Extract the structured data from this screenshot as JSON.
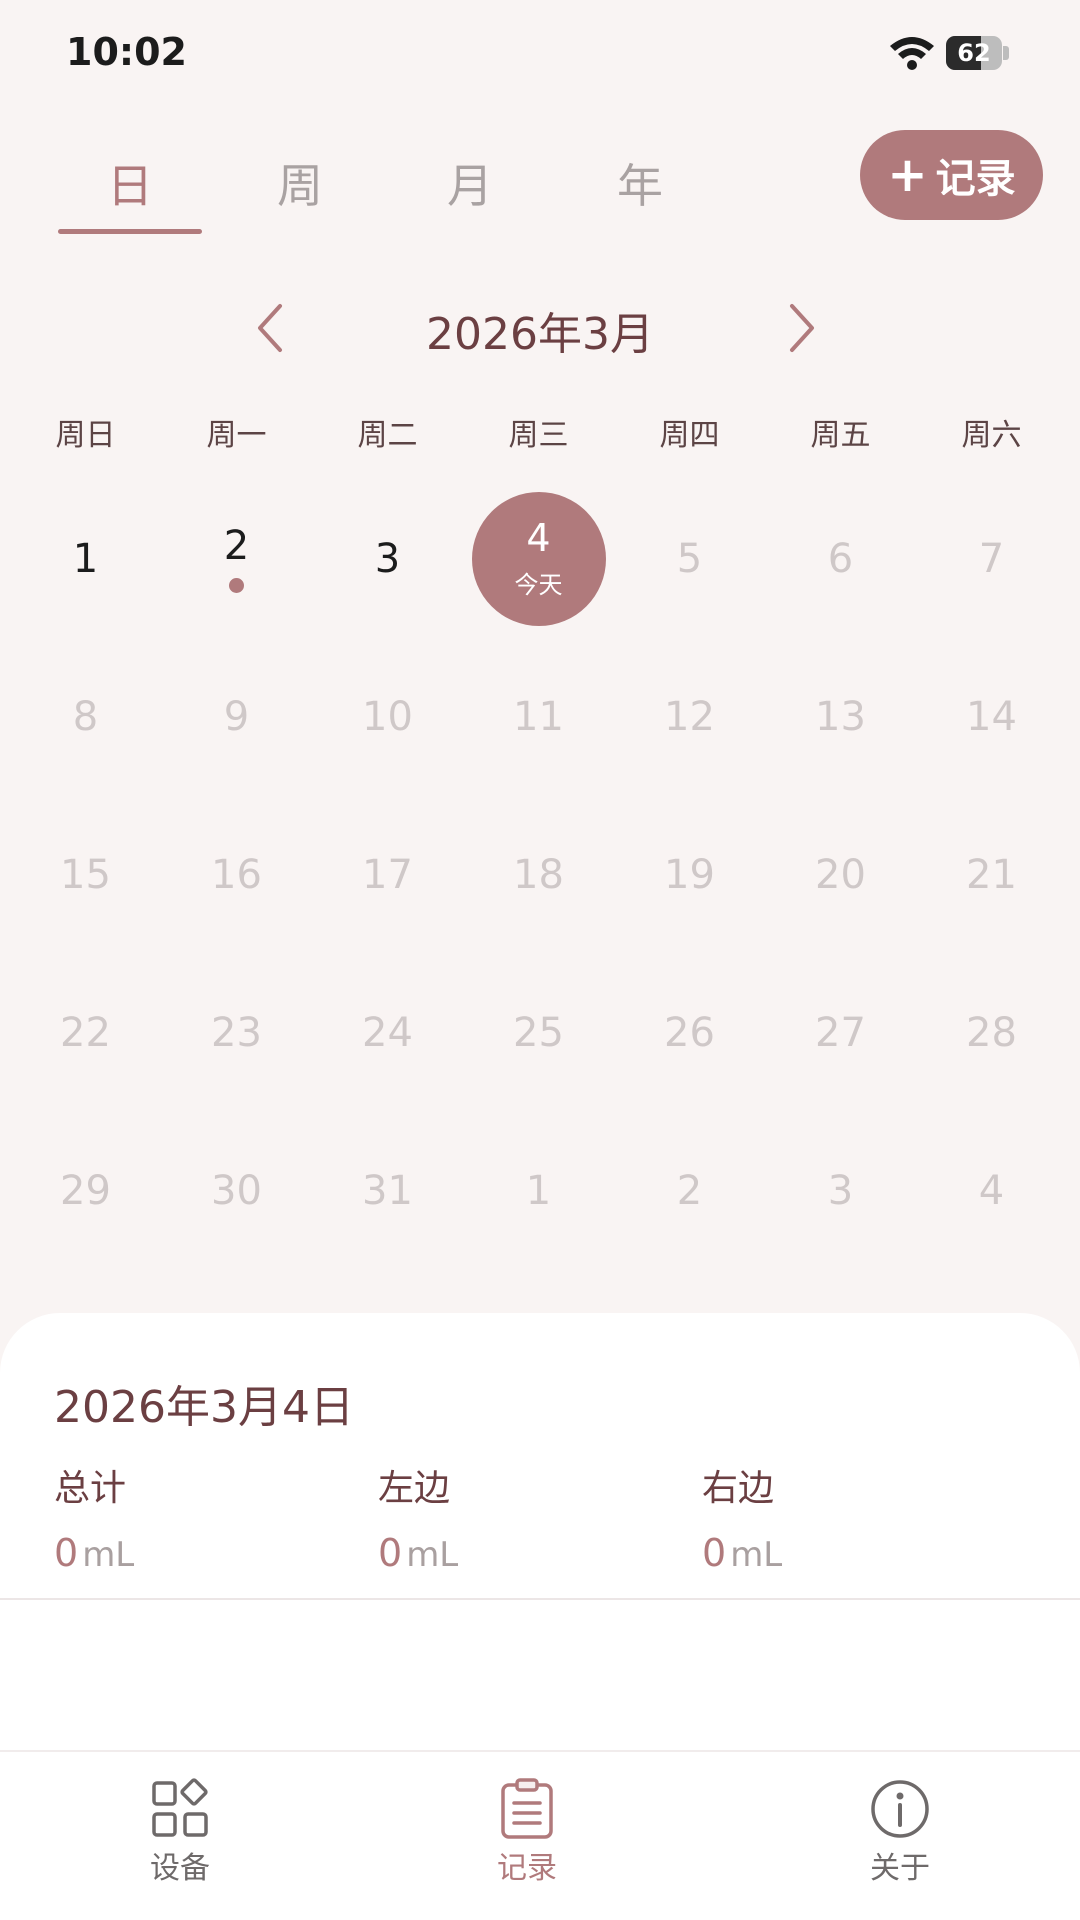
{
  "status_bar": {
    "time": "10:02",
    "battery_percent": 62,
    "battery_text": "62",
    "icons": [
      "wifi-icon",
      "battery-icon"
    ]
  },
  "tabs": [
    {
      "label": "日",
      "active": true
    },
    {
      "label": "周",
      "active": false
    },
    {
      "label": "月",
      "active": false
    },
    {
      "label": "年",
      "active": false
    }
  ],
  "record_button": {
    "icon": "plus-icon",
    "plus": "+",
    "label": "记录"
  },
  "calendar": {
    "month_title": "2026年3月",
    "weekdays": [
      "周日",
      "周一",
      "周二",
      "周三",
      "周四",
      "周五",
      "周六"
    ],
    "weeks": [
      [
        {
          "d": "1",
          "state": "past"
        },
        {
          "d": "2",
          "state": "past",
          "dot": true
        },
        {
          "d": "3",
          "state": "past"
        },
        {
          "d": "4",
          "state": "today",
          "label": "今天"
        },
        {
          "d": "5",
          "state": "future"
        },
        {
          "d": "6",
          "state": "future"
        },
        {
          "d": "7",
          "state": "future"
        }
      ],
      [
        {
          "d": "8",
          "state": "future"
        },
        {
          "d": "9",
          "state": "future"
        },
        {
          "d": "10",
          "state": "future"
        },
        {
          "d": "11",
          "state": "future"
        },
        {
          "d": "12",
          "state": "future"
        },
        {
          "d": "13",
          "state": "future"
        },
        {
          "d": "14",
          "state": "future"
        }
      ],
      [
        {
          "d": "15",
          "state": "future"
        },
        {
          "d": "16",
          "state": "future"
        },
        {
          "d": "17",
          "state": "future"
        },
        {
          "d": "18",
          "state": "future"
        },
        {
          "d": "19",
          "state": "future"
        },
        {
          "d": "20",
          "state": "future"
        },
        {
          "d": "21",
          "state": "future"
        }
      ],
      [
        {
          "d": "22",
          "state": "future"
        },
        {
          "d": "23",
          "state": "future"
        },
        {
          "d": "24",
          "state": "future"
        },
        {
          "d": "25",
          "state": "future"
        },
        {
          "d": "26",
          "state": "future"
        },
        {
          "d": "27",
          "state": "future"
        },
        {
          "d": "28",
          "state": "future"
        }
      ],
      [
        {
          "d": "29",
          "state": "future"
        },
        {
          "d": "30",
          "state": "future"
        },
        {
          "d": "31",
          "state": "future"
        },
        {
          "d": "1",
          "state": "future"
        },
        {
          "d": "2",
          "state": "future"
        },
        {
          "d": "3",
          "state": "future"
        },
        {
          "d": "4",
          "state": "future"
        }
      ]
    ]
  },
  "summary": {
    "date": "2026年3月4日",
    "stats": [
      {
        "label": "总计",
        "value": "0",
        "unit": "mL"
      },
      {
        "label": "左边",
        "value": "0",
        "unit": "mL"
      },
      {
        "label": "右边",
        "value": "0",
        "unit": "mL"
      }
    ]
  },
  "bottom_nav": [
    {
      "label": "设备",
      "icon": "device-grid-icon",
      "active": false
    },
    {
      "label": "记录",
      "icon": "clipboard-list-icon",
      "active": true
    },
    {
      "label": "关于",
      "icon": "info-icon",
      "active": false
    }
  ],
  "colors": {
    "accent": "#b07a7c",
    "title": "#6b3f42",
    "background": "#f9f4f3",
    "muted_day": "#cfc8c8"
  }
}
